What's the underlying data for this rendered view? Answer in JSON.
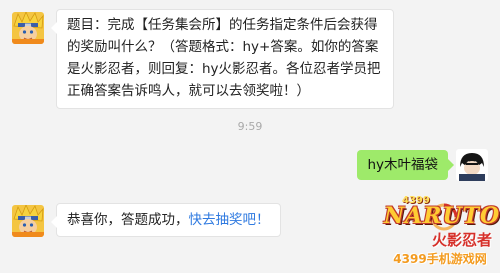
{
  "chat": {
    "message_1": "题目：完成【任务集会所】的任务指定条件后会获得的奖励叫什么？（答题格式：hy+答案。如你的答案是火影忍者，则回复：hy火影忍者。各位忍者学员把正确答案告诉鸣人，就可以去领奖啦！）",
    "timestamp": "9:59",
    "user_reply": "hy木叶福袋",
    "message_2_text": "恭喜你，答题成功，",
    "message_2_link": "快去抽奖吧！"
  },
  "watermark": {
    "number": "4399",
    "brand": "NARUTO",
    "cn_title": "火影忍者",
    "site": "4399手机游戏网"
  },
  "colors": {
    "background": "#f3f3f3",
    "sent_bubble": "#9eea6a",
    "link": "#2f7ae0"
  }
}
